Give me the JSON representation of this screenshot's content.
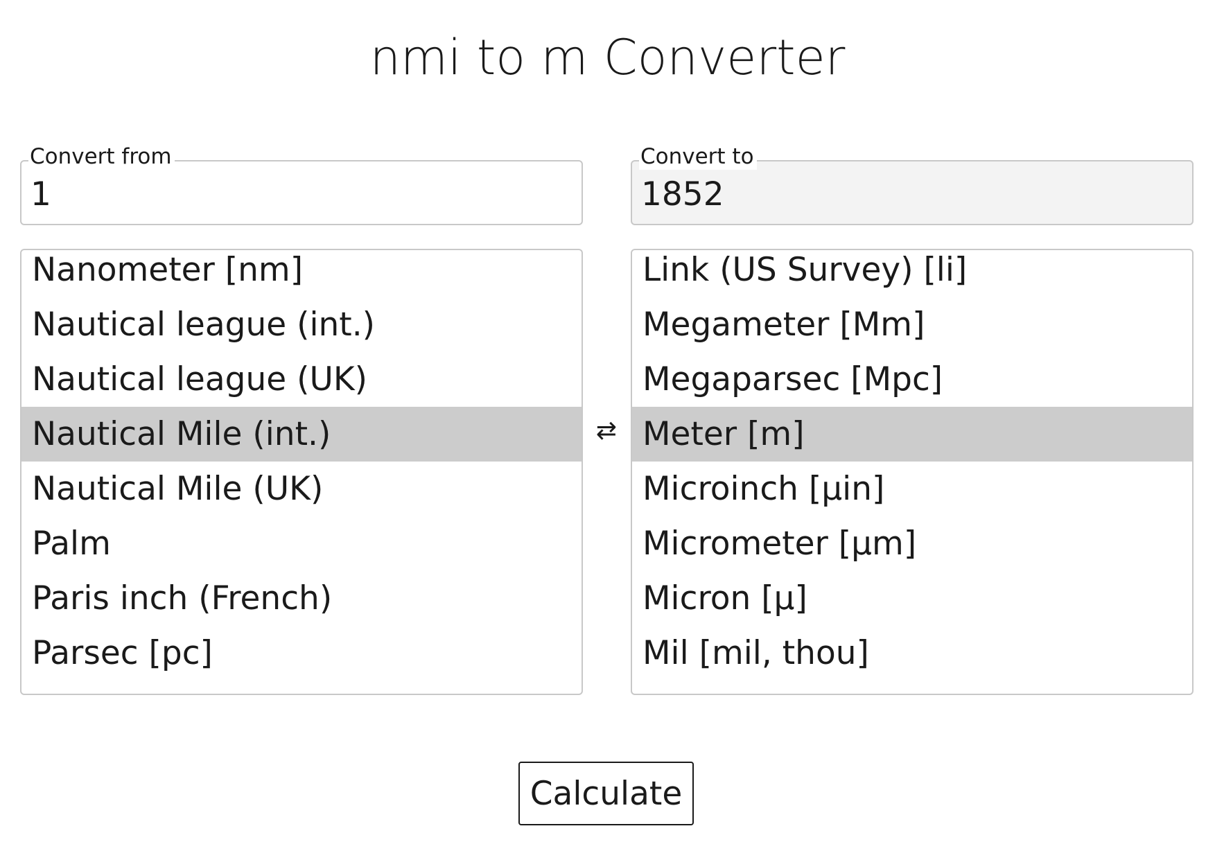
{
  "page": {
    "title": "nmi to m Converter"
  },
  "from": {
    "legend": "Convert from",
    "value": "1",
    "units": [
      "Nanometer [nm]",
      "Nautical league (int.)",
      "Nautical league (UK)",
      "Nautical Mile (int.)",
      "Nautical Mile (UK)",
      "Palm",
      "Paris inch (French)",
      "Parsec [pc]"
    ],
    "selected_unit": "Nautical Mile (int.)"
  },
  "to": {
    "legend": "Convert to",
    "value": "1852",
    "units": [
      "Link (US Survey) [li]",
      "Megameter [Mm]",
      "Megaparsec [Mpc]",
      "Meter [m]",
      "Microinch [µin]",
      "Micrometer [µm]",
      "Micron [µ]",
      "Mil [mil, thou]"
    ],
    "selected_unit": "Meter [m]"
  },
  "swap": {
    "symbol": "⇄"
  },
  "actions": {
    "calculate_label": "Calculate"
  },
  "colors": {
    "selected_background": "#cccccc",
    "readonly_background": "#f3f3f3",
    "border": "#c8c8c8"
  }
}
